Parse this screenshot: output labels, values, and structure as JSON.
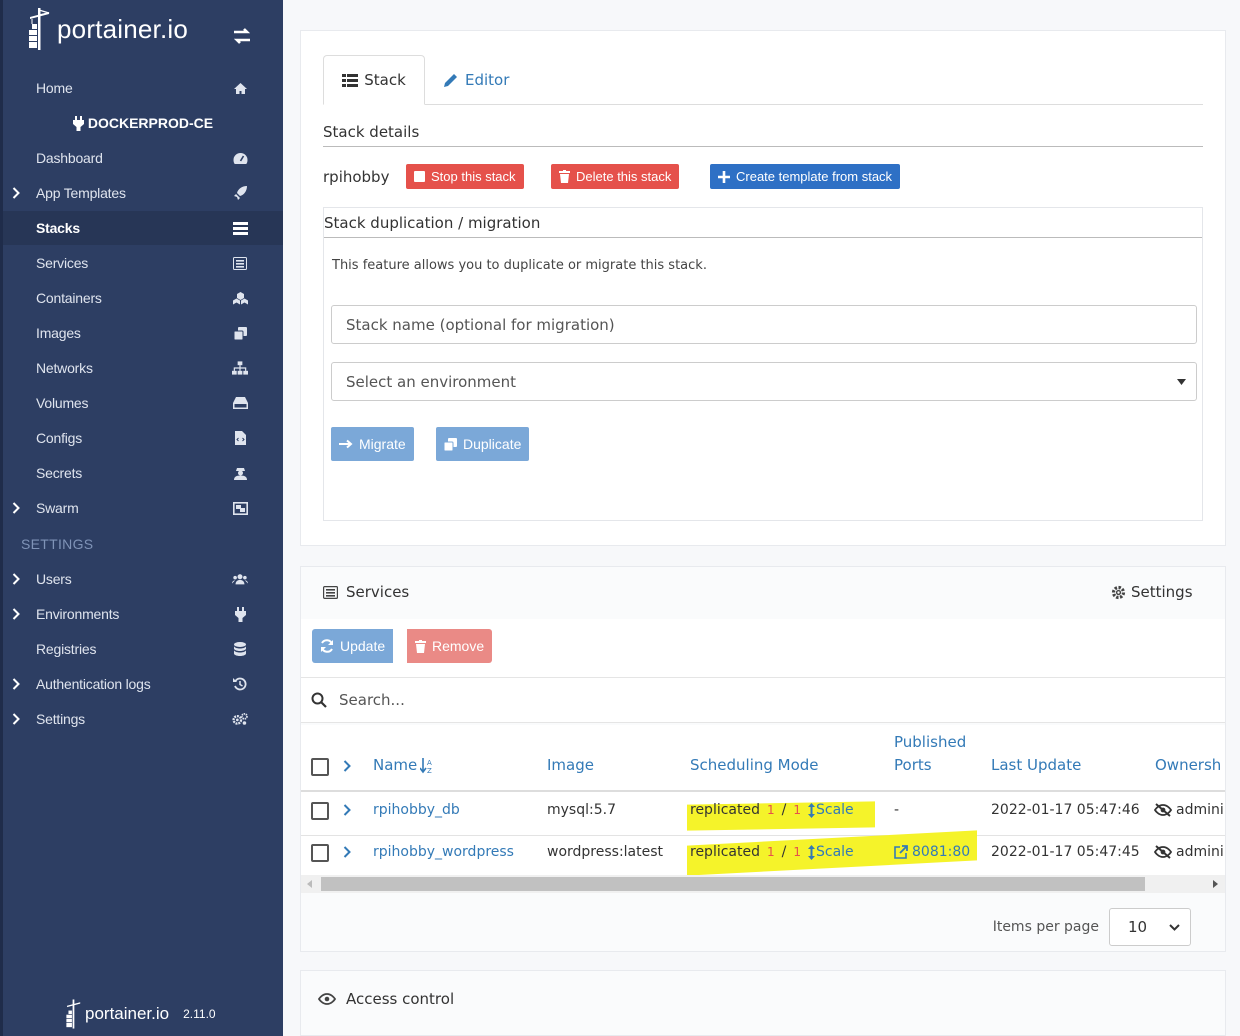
{
  "app": {
    "logo_text": "portainer.io",
    "version": "2.11.0"
  },
  "sidebar": {
    "environment": "DOCKERPROD-CE",
    "settings_header": "SETTINGS",
    "items": [
      {
        "label": "Home",
        "icon": "home-icon"
      },
      {
        "label": "Dashboard",
        "icon": "dashboard-icon"
      },
      {
        "label": "App Templates",
        "icon": "rocket-icon"
      },
      {
        "label": "Stacks",
        "icon": "list-icon"
      },
      {
        "label": "Services",
        "icon": "services-icon"
      },
      {
        "label": "Containers",
        "icon": "cubes-icon"
      },
      {
        "label": "Images",
        "icon": "clone-icon"
      },
      {
        "label": "Networks",
        "icon": "sitemap-icon"
      },
      {
        "label": "Volumes",
        "icon": "hdd-icon"
      },
      {
        "label": "Configs",
        "icon": "file-code-icon"
      },
      {
        "label": "Secrets",
        "icon": "user-secret-icon"
      },
      {
        "label": "Swarm",
        "icon": "object-group-icon"
      },
      {
        "label": "Users",
        "icon": "users-icon"
      },
      {
        "label": "Environments",
        "icon": "plug-icon"
      },
      {
        "label": "Registries",
        "icon": "database-icon"
      },
      {
        "label": "Authentication logs",
        "icon": "history-icon"
      },
      {
        "label": "Settings",
        "icon": "cogs-icon"
      }
    ]
  },
  "stack": {
    "tabs": [
      {
        "label": "Stack",
        "active": true
      },
      {
        "label": "Editor",
        "active": false
      }
    ],
    "details_title": "Stack details",
    "name": "rpihobby",
    "buttons": {
      "stop": "Stop this stack",
      "delete": "Delete this stack",
      "template": "Create template from stack"
    },
    "duplication": {
      "title": "Stack duplication / migration",
      "description": "This feature allows you to duplicate or migrate this stack.",
      "name_placeholder": "Stack name (optional for migration)",
      "environment_select": "Select an environment",
      "migrate": "Migrate",
      "duplicate": "Duplicate"
    }
  },
  "services": {
    "title": "Services",
    "settings": "Settings",
    "update": "Update",
    "remove": "Remove",
    "search_placeholder": "Search...",
    "columns": {
      "name": "Name",
      "image": "Image",
      "scheduling": "Scheduling Mode",
      "ports_line1": "Published",
      "ports_line2": "Ports",
      "last_update": "Last Update",
      "ownership": "Ownersh"
    },
    "rows": [
      {
        "name": "rpihobby_db",
        "image": "mysql:5.7",
        "mode": "replicated",
        "running": "1",
        "sep": "/",
        "desired": "1",
        "scale": "Scale",
        "ports": "-",
        "last_update": "2022-01-17 05:47:46",
        "ownership": "admini"
      },
      {
        "name": "rpihobby_wordpress",
        "image": "wordpress:latest",
        "mode": "replicated",
        "running": "1",
        "sep": "/",
        "desired": "1",
        "scale": "Scale",
        "ports": "8081:80",
        "last_update": "2022-01-17 05:47:45",
        "ownership": "admini"
      }
    ],
    "items_per_page_label": "Items per page",
    "items_per_page": "10"
  },
  "access_control": {
    "title": "Access control"
  },
  "colors": {
    "sidebar": "#2d3e63",
    "danger": "#e5514b",
    "primary": "#2e70c5",
    "link": "#337ab7",
    "highlight": "#f5f32a"
  }
}
